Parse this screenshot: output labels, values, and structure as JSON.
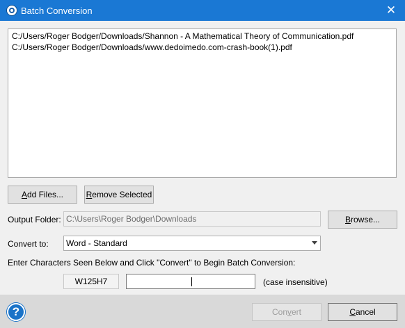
{
  "window": {
    "title": "Batch Conversion",
    "close_symbol": "✕"
  },
  "file_list": {
    "items": [
      "C:/Users/Roger Bodger/Downloads/Shannon - A Mathematical Theory of Communication.pdf",
      "C:/Users/Roger Bodger/Downloads/www.dedoimedo.com-crash-book(1).pdf"
    ]
  },
  "buttons": {
    "add_files_mnemonic": "A",
    "add_files_rest": "dd Files...",
    "remove_selected_mnemonic": "R",
    "remove_selected_rest": "emove Selected",
    "browse_mnemonic": "B",
    "browse_rest": "rowse...",
    "convert_pre": "Con",
    "convert_mnemonic": "v",
    "convert_post": "ert",
    "cancel_mnemonic": "C",
    "cancel_rest": "ancel",
    "help_symbol": "?"
  },
  "output_folder": {
    "label": "Output Folder:",
    "value": "C:\\Users\\Roger Bodger\\Downloads"
  },
  "convert_to": {
    "label": "Convert to:",
    "selected": "Word - Standard"
  },
  "captcha": {
    "instruction": "Enter Characters Seen Below and Click \"Convert\" to Begin Batch Conversion:",
    "code": "W125H7",
    "input_value": "",
    "note": "(case insensitive)"
  },
  "colors": {
    "titlebar": "#1a78d4",
    "help": "#1a73c8",
    "footer": "#d9d9d9"
  }
}
